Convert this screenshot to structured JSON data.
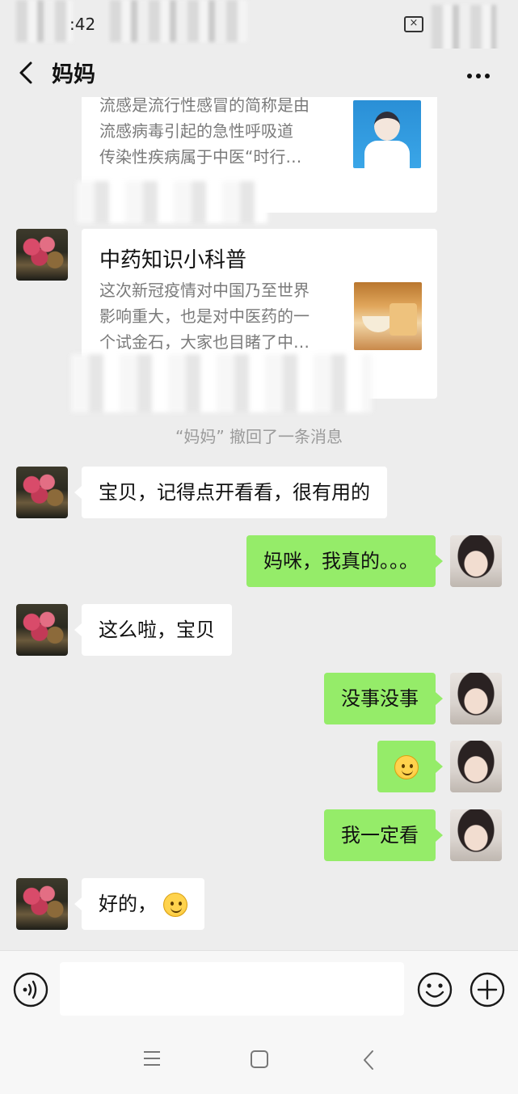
{
  "status_bar": {
    "time": ":42"
  },
  "header": {
    "title": "妈妈"
  },
  "messages": {
    "card1": {
      "desc_line1": "流感是流行性感冒的简称是由",
      "desc_line2": "流感病毒引起的急性呼吸道",
      "desc_line3": "传染性疾病属于中医“时行…"
    },
    "card2": {
      "title": "中药知识小科普",
      "desc_line1": "这次新冠疫情对中国乃至世界",
      "desc_line2": "影响重大，也是对中医药的一",
      "desc_line3": "个试金石，大家也目睹了中…",
      "source_fragment": "药"
    },
    "recall_notice": "“妈妈” 撤回了一条消息",
    "msg1": "宝贝，记得点开看看，很有用的",
    "msg2": "妈咪，我真的。。。",
    "msg3": "这么啦，宝贝",
    "msg4": "没事没事",
    "msg5_emoji": "smile-emoji",
    "msg6": "我一定看",
    "msg7_text": "好的，",
    "msg7_emoji": "smile-emoji"
  },
  "input_bar": {
    "text_value": "",
    "placeholder": ""
  },
  "icons": {
    "back": "chevron-left-icon",
    "more": "more-dots-icon",
    "voice": "voice-icon",
    "emoji": "emoji-icon",
    "plus": "plus-icon"
  },
  "colors": {
    "background": "#ededed",
    "incoming_bubble": "#ffffff",
    "outgoing_bubble": "#95ec69",
    "system_text": "#9b9b9b",
    "card_desc": "#7a7a7a"
  }
}
